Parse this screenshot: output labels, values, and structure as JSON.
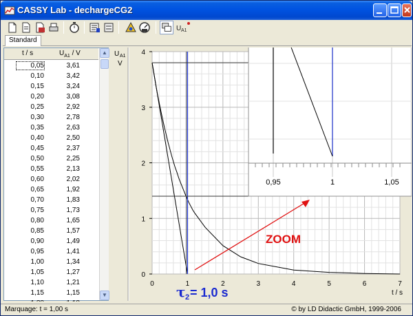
{
  "window": {
    "title": "CASSY Lab - dechargeCG2"
  },
  "tabs": [
    {
      "label": "Standard"
    }
  ],
  "table": {
    "col_t": "t / s",
    "col_u": "U",
    "col_u_sub": "A1",
    "col_u_unit": " / V",
    "rows": [
      [
        "0,05",
        "3,61"
      ],
      [
        "0,10",
        "3,42"
      ],
      [
        "0,15",
        "3,24"
      ],
      [
        "0,20",
        "3,08"
      ],
      [
        "0,25",
        "2,92"
      ],
      [
        "0,30",
        "2,78"
      ],
      [
        "0,35",
        "2,63"
      ],
      [
        "0,40",
        "2,50"
      ],
      [
        "0,45",
        "2,37"
      ],
      [
        "0,50",
        "2,25"
      ],
      [
        "0,55",
        "2,13"
      ],
      [
        "0,60",
        "2,02"
      ],
      [
        "0,65",
        "1,92"
      ],
      [
        "0,70",
        "1,83"
      ],
      [
        "0,75",
        "1,73"
      ],
      [
        "0,80",
        "1,65"
      ],
      [
        "0,85",
        "1,57"
      ],
      [
        "0,90",
        "1,49"
      ],
      [
        "0,95",
        "1,41"
      ],
      [
        "1,00",
        "1,34"
      ],
      [
        "1,05",
        "1,27"
      ],
      [
        "1,10",
        "1,21"
      ],
      [
        "1,15",
        "1,15"
      ],
      [
        "1,20",
        "1,10"
      ]
    ]
  },
  "graph": {
    "y_axis_label": "U",
    "y_axis_sub": "A1",
    "y_axis_unit": "V",
    "x_axis_label": "t / s",
    "y_ticks": [
      "0",
      "1",
      "2",
      "3",
      "4"
    ],
    "x_ticks": [
      "0",
      "1",
      "2",
      "3",
      "4",
      "5",
      "6",
      "7"
    ],
    "zoom_ticks": [
      "0,95",
      "1",
      "1,05"
    ],
    "zoom_label": "ZOOM",
    "tau_symbol": "τ",
    "tau_sub": "2",
    "tau_value": " = 1,0 s",
    "colors": {
      "zoom_text": "#e01010",
      "tau_text": "#1a2ad0",
      "marker": "#1a30c8",
      "curve": "#000000",
      "arrow": "#e01010"
    }
  },
  "chart_data": {
    "type": "line",
    "xlabel": "t / s",
    "ylabel": "UA1 / V",
    "xlim": [
      0,
      7
    ],
    "ylim": [
      0,
      4
    ],
    "grid": true,
    "series": [
      {
        "x": [
          0.05,
          0.1,
          0.15,
          0.2,
          0.25,
          0.3,
          0.35,
          0.4,
          0.45,
          0.5,
          0.55,
          0.6,
          0.65,
          0.7,
          0.75,
          0.8,
          0.85,
          0.9,
          0.95,
          1.0,
          1.05,
          1.1,
          1.15,
          1.2,
          1.5,
          2.0,
          2.5,
          3.0,
          4.0,
          5.0,
          6.0,
          7.0
        ],
        "y": [
          3.61,
          3.42,
          3.24,
          3.08,
          2.92,
          2.78,
          2.63,
          2.5,
          2.37,
          2.25,
          2.13,
          2.02,
          1.92,
          1.83,
          1.73,
          1.65,
          1.57,
          1.49,
          1.41,
          1.34,
          1.27,
          1.21,
          1.15,
          1.1,
          0.84,
          0.51,
          0.31,
          0.19,
          0.07,
          0.03,
          0.01,
          0.0
        ]
      },
      {
        "x": [
          0,
          1.0
        ],
        "y": [
          3.8,
          0
        ]
      }
    ],
    "markers": {
      "x": [
        1.0
      ],
      "y": [
        1.4,
        3.8
      ]
    }
  },
  "status": {
    "marker_text": "Marquage:  t = 1,00 s",
    "copyright": "© by LD Didactic GmbH, 1999-2006"
  }
}
